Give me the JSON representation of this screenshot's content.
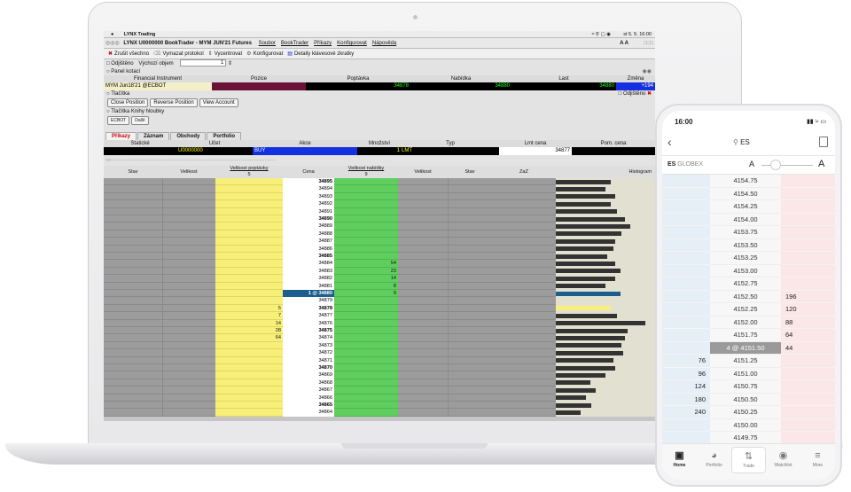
{
  "menubar": {
    "app": "LYNX Trading",
    "clock": "st 5. 5.  16:00"
  },
  "window": {
    "title": "LYNX  U0000000 BookTrader - MYM JUN'21 Futures",
    "menus": [
      "Soubor",
      "BookTrader",
      "Příkazy",
      "Konfigurovat",
      "Nápověda"
    ]
  },
  "toolbar": {
    "items": [
      "Zrušit všechno",
      "Vymazat protokol",
      "Vycentrovat",
      "Konfigurovat",
      "Detaily klávesové zkratky"
    ]
  },
  "options": {
    "hedge": "Odjištěno",
    "default_volume_label": "Výchozí objem",
    "default_volume": "1"
  },
  "quote_panel": {
    "title": "Panel kotací",
    "headers": [
      "Financial Instrument",
      "Pozice",
      "Poptávka",
      "Nabídka",
      "Last",
      "Změna"
    ],
    "instrument": "MYM Jun18'21 @ECBOT",
    "bid": "34878",
    "ask": "34880",
    "last": "34880",
    "change": "+194"
  },
  "buttons_panel": {
    "title": "Tlačítka",
    "hedge": "Odjištěno",
    "buttons": [
      "Close Position",
      "Reverse Position",
      "View Account"
    ]
  },
  "depth_panel": {
    "title": "Tlačítka Knihy hloubky",
    "buttons": [
      "ECBOT",
      "Další"
    ]
  },
  "order_tabs": {
    "tabs": [
      "Příkazy",
      "Záznam",
      "Obchody",
      "Portfolio"
    ],
    "headers": [
      "Statické",
      "Účet",
      "Akce",
      "Množství",
      "Typ",
      "Lmt cena",
      "Pom. cena"
    ],
    "account": "U0000000",
    "action": "BUY",
    "quantity": "1",
    "type": "LMT",
    "lmt_price": "34877"
  },
  "ladder": {
    "headers": {
      "stav": "Stav",
      "velikost": "Velikost",
      "bid_size": "Velikost poptávky",
      "bid_total": "5",
      "price": "Cena",
      "ask_size": "Velikost nabídky",
      "ask_total": "9",
      "velikost2": "Velikost",
      "stav2": "Stav",
      "zaz": "ZaZ",
      "histogram": "Histogram"
    },
    "rows": [
      {
        "price": "34895",
        "bid": "",
        "ask": "",
        "bold": true,
        "hist": 0.55
      },
      {
        "price": "34894",
        "bid": "",
        "ask": "",
        "bold": false,
        "hist": 0.5
      },
      {
        "price": "34893",
        "bid": "",
        "ask": "",
        "bold": false,
        "hist": 0.6
      },
      {
        "price": "34892",
        "bid": "",
        "ask": "",
        "bold": false,
        "hist": 0.55
      },
      {
        "price": "34891",
        "bid": "",
        "ask": "",
        "bold": false,
        "hist": 0.62
      },
      {
        "price": "34890",
        "bid": "",
        "ask": "",
        "bold": true,
        "hist": 0.7
      },
      {
        "price": "34889",
        "bid": "",
        "ask": "",
        "bold": false,
        "hist": 0.75
      },
      {
        "price": "34888",
        "bid": "",
        "ask": "",
        "bold": false,
        "hist": 0.66
      },
      {
        "price": "34887",
        "bid": "",
        "ask": "",
        "bold": false,
        "hist": 0.6
      },
      {
        "price": "34886",
        "bid": "",
        "ask": "",
        "bold": false,
        "hist": 0.58
      },
      {
        "price": "34885",
        "bid": "",
        "ask": "",
        "bold": true,
        "hist": 0.52
      },
      {
        "price": "34884",
        "bid": "",
        "ask": "54",
        "bold": false,
        "hist": 0.6
      },
      {
        "price": "34883",
        "bid": "",
        "ask": "23",
        "bold": false,
        "hist": 0.65
      },
      {
        "price": "34882",
        "bid": "",
        "ask": "14",
        "bold": false,
        "hist": 0.6
      },
      {
        "price": "34881",
        "bid": "",
        "ask": "8",
        "bold": false,
        "hist": 0.5
      },
      {
        "price": "1 @ 34880",
        "bid": "",
        "ask": "9",
        "bold": true,
        "hist": 0.65,
        "current": true
      },
      {
        "price": "34879",
        "bid": "",
        "ask": "",
        "bold": false,
        "hist": 0.0
      },
      {
        "price": "34878",
        "bid": "5",
        "ask": "",
        "bold": true,
        "hist": 0.55,
        "yellowhist": true
      },
      {
        "price": "34877",
        "bid": "7",
        "ask": "",
        "bold": false,
        "hist": 0.62
      },
      {
        "price": "34876",
        "bid": "14",
        "ask": "",
        "bold": false,
        "hist": 0.9
      },
      {
        "price": "34875",
        "bid": "28",
        "ask": "",
        "bold": true,
        "hist": 0.72
      },
      {
        "price": "34874",
        "bid": "64",
        "ask": "",
        "bold": false,
        "hist": 0.7
      },
      {
        "price": "34873",
        "bid": "",
        "ask": "",
        "bold": false,
        "hist": 0.66
      },
      {
        "price": "34872",
        "bid": "",
        "ask": "",
        "bold": false,
        "hist": 0.68
      },
      {
        "price": "34871",
        "bid": "",
        "ask": "",
        "bold": false,
        "hist": 0.58
      },
      {
        "price": "34870",
        "bid": "",
        "ask": "",
        "bold": true,
        "hist": 0.6
      },
      {
        "price": "34869",
        "bid": "",
        "ask": "",
        "bold": false,
        "hist": 0.5
      },
      {
        "price": "34868",
        "bid": "",
        "ask": "",
        "bold": false,
        "hist": 0.35
      },
      {
        "price": "34867",
        "bid": "",
        "ask": "",
        "bold": false,
        "hist": 0.4
      },
      {
        "price": "34866",
        "bid": "",
        "ask": "",
        "bold": false,
        "hist": 0.3
      },
      {
        "price": "34865",
        "bid": "",
        "ask": "",
        "bold": true,
        "hist": 0.36
      },
      {
        "price": "34864",
        "bid": "",
        "ask": "",
        "bold": false,
        "hist": 0.25
      }
    ]
  },
  "phone": {
    "time": "16:00",
    "search": "ES",
    "symbol": "ES",
    "exchange": "GLOBEX",
    "zoom_out": "A",
    "zoom_in": "A",
    "rows": [
      {
        "price": "4154.75",
        "bid": "",
        "ask": ""
      },
      {
        "price": "4154.50",
        "bid": "",
        "ask": ""
      },
      {
        "price": "4154.25",
        "bid": "",
        "ask": ""
      },
      {
        "price": "4154.00",
        "bid": "",
        "ask": ""
      },
      {
        "price": "4153.75",
        "bid": "",
        "ask": ""
      },
      {
        "price": "4153.50",
        "bid": "",
        "ask": ""
      },
      {
        "price": "4153.25",
        "bid": "",
        "ask": ""
      },
      {
        "price": "4153.00",
        "bid": "",
        "ask": ""
      },
      {
        "price": "4152.75",
        "bid": "",
        "ask": ""
      },
      {
        "price": "4152.50",
        "bid": "",
        "ask": "196"
      },
      {
        "price": "4152.25",
        "bid": "",
        "ask": "120"
      },
      {
        "price": "4152.00",
        "bid": "",
        "ask": "88"
      },
      {
        "price": "4151.75",
        "bid": "",
        "ask": "64"
      },
      {
        "price": "4 @ 4151.50",
        "bid": "",
        "ask": "44",
        "current": true
      },
      {
        "price": "4151.25",
        "bid": "76",
        "ask": ""
      },
      {
        "price": "4151.00",
        "bid": "96",
        "ask": ""
      },
      {
        "price": "4150.75",
        "bid": "124",
        "ask": ""
      },
      {
        "price": "4150.50",
        "bid": "180",
        "ask": ""
      },
      {
        "price": "4150.25",
        "bid": "240",
        "ask": ""
      },
      {
        "price": "4150.00",
        "bid": "",
        "ask": ""
      },
      {
        "price": "4149.75",
        "bid": "",
        "ask": ""
      }
    ],
    "nav": [
      "Home",
      "Portfolio",
      "Trade",
      "Watchlist",
      "More"
    ]
  },
  "colors": {
    "bid": "#f7ef7a",
    "ask": "#5fce5f",
    "current": "#1d5f8c",
    "position": "#6b1238",
    "change": "#1530e0"
  }
}
